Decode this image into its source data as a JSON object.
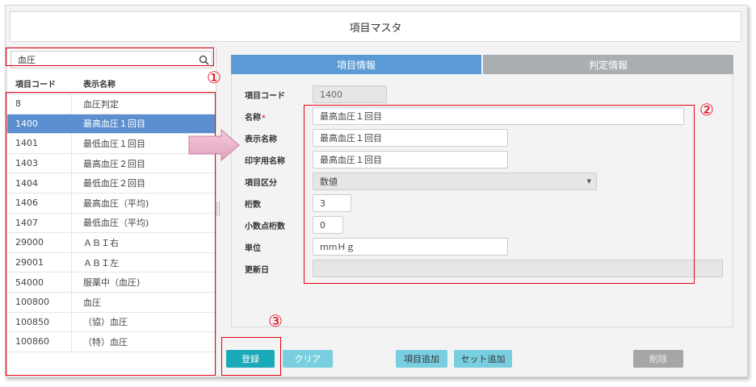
{
  "window": {
    "title": "項目マスタ"
  },
  "search": {
    "value": "血圧",
    "icon": "search-icon"
  },
  "list": {
    "headers": {
      "code": "項目コード",
      "name": "表示名称"
    },
    "rows": [
      {
        "code": "8",
        "name": "血圧判定"
      },
      {
        "code": "1400",
        "name": "最高血圧１回目"
      },
      {
        "code": "1401",
        "name": "最低血圧１回目"
      },
      {
        "code": "1403",
        "name": "最高血圧２回目"
      },
      {
        "code": "1404",
        "name": "最低血圧２回目"
      },
      {
        "code": "1406",
        "name": "最高血圧（平均)"
      },
      {
        "code": "1407",
        "name": "最低血圧（平均)"
      },
      {
        "code": "29000",
        "name": "ＡＢＩ右"
      },
      {
        "code": "29001",
        "name": "ＡＢＩ左"
      },
      {
        "code": "54000",
        "name": "服薬中（血圧)"
      },
      {
        "code": "100800",
        "name": "血圧"
      },
      {
        "code": "100850",
        "name": "（協）血圧"
      },
      {
        "code": "100860",
        "name": "（特）血圧"
      }
    ],
    "selected_index": 1
  },
  "tabs": {
    "active": "項目情報",
    "inactive": "判定情報"
  },
  "form": {
    "code_label": "項目コード",
    "code_value": "1400",
    "name_label": "名称",
    "required_mark": "*",
    "name_value": "最高血圧１回目",
    "display_label": "表示名称",
    "display_value": "最高血圧１回目",
    "print_label": "印字用名称",
    "print_value": "最高血圧１回目",
    "type_label": "項目区分",
    "type_value": "数値",
    "digits_label": "桁数",
    "digits_value": "3",
    "decimal_label": "小数点桁数",
    "decimal_value": "0",
    "unit_label": "単位",
    "unit_value": "mmＨｇ",
    "updated_label": "更新日",
    "updated_value": ""
  },
  "buttons": {
    "register": "登録",
    "clear": "クリア",
    "add_item": "項目追加",
    "add_set": "セット追加",
    "delete": "削除"
  },
  "annotations": {
    "one": "①",
    "two": "②",
    "three": "③"
  },
  "colors": {
    "accent": "#5b9bd5",
    "selected_row": "#5b8fcf",
    "annotation": "#e60012",
    "register": "#1aa9b8"
  }
}
